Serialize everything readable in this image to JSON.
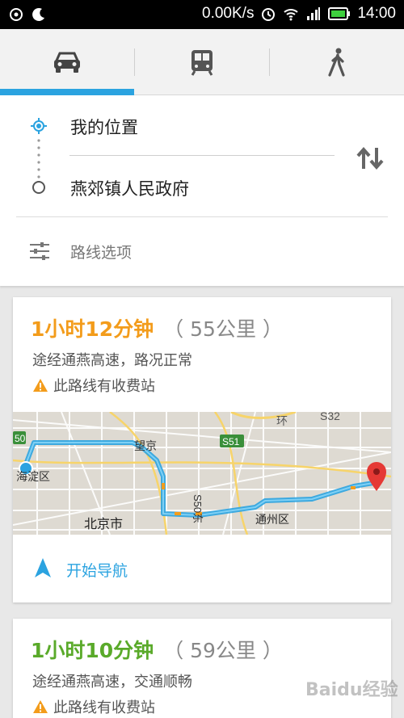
{
  "status_bar": {
    "network_speed": "0.00K/s",
    "time": "14:00",
    "icons": [
      "notification-app-icon",
      "moon-icon",
      "alarm-icon",
      "wifi-icon",
      "signal-icon",
      "battery-icon"
    ]
  },
  "tabs": [
    {
      "name": "driving",
      "icon": "car-icon",
      "selected": true
    },
    {
      "name": "transit",
      "icon": "bus-icon",
      "selected": false
    },
    {
      "name": "walking",
      "icon": "walk-icon",
      "selected": false
    }
  ],
  "route": {
    "origin": "我的位置",
    "destination": "燕郊镇人民政府",
    "options_label": "路线选项"
  },
  "results": [
    {
      "duration": "1小时12分钟",
      "distance": "（ 55公里 ）",
      "via": "途经通燕高速，路况正常",
      "toll_warning": "此路线有收费站",
      "duration_color": "#f39c1b",
      "map": {
        "labels": [
          "50",
          "海淀区",
          "望京",
          "S51",
          "S32",
          "环",
          "北京市",
          "S50东",
          "通州区"
        ]
      },
      "start_nav_label": "开始导航"
    },
    {
      "duration": "1小时10分钟",
      "distance": "（ 59公里 ）",
      "via": "途经通燕高速，交通顺畅",
      "toll_warning": "此路线有收费站",
      "duration_color": "#5aaa2a"
    }
  ],
  "colors": {
    "accent": "#2ba3e0",
    "warning": "#f39c1b",
    "route_line": "#2ba3e0",
    "destination_pin": "#e53935"
  },
  "watermark": "Baidu经验"
}
